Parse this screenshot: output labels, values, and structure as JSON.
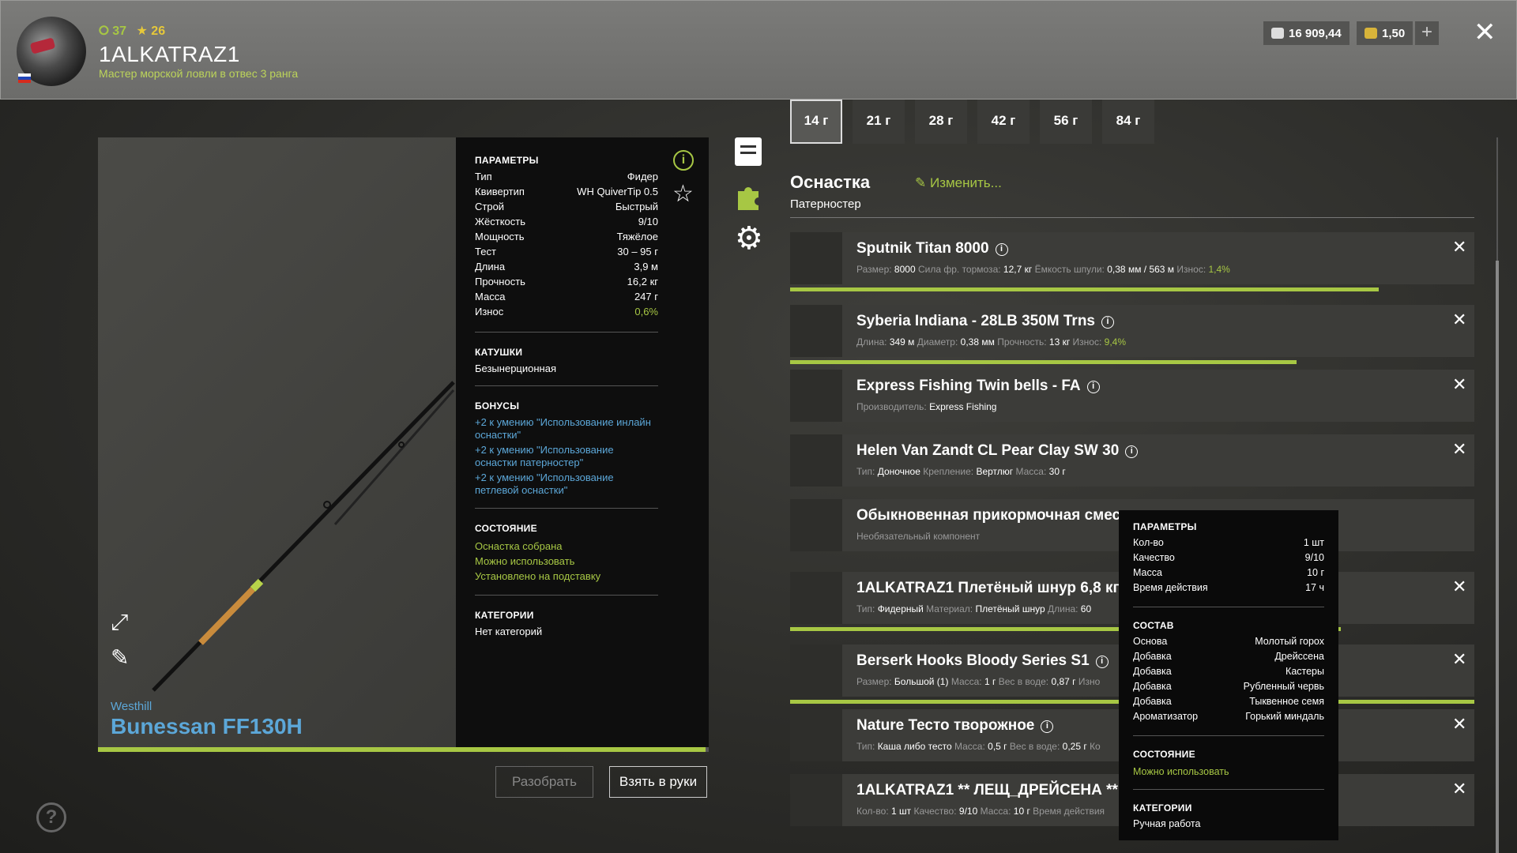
{
  "header": {
    "level": "37",
    "stars": "26",
    "player_name": "1ALKATRAZ1",
    "player_title": "Мастер морской ловли в отвес 3 ранга",
    "silver": "16 909,44",
    "gold": "1,50",
    "plus": "+",
    "close": "✕"
  },
  "rod": {
    "brand": "Westhill",
    "name": "Bunessan FF130H",
    "progress": 0.995,
    "params_title": "ПАРАМЕТРЫ",
    "params": [
      {
        "k": "Тип",
        "v": "Фидер"
      },
      {
        "k": "Квивертип",
        "v": "WH QuiverTip 0.5"
      },
      {
        "k": "Строй",
        "v": "Быстрый"
      },
      {
        "k": "Жёсткость",
        "v": "9/10"
      },
      {
        "k": "Мощность",
        "v": "Тяжёлое"
      },
      {
        "k": "Тест",
        "v": "30 – 95 г"
      },
      {
        "k": "Длина",
        "v": "3,9 м"
      },
      {
        "k": "Прочность",
        "v": "16,2 кг"
      },
      {
        "k": "Масса",
        "v": "247 г"
      },
      {
        "k": "Износ",
        "v": "0,6%"
      }
    ],
    "reels_title": "КАТУШКИ",
    "reels_value": "Безынерционная",
    "bonuses_title": "БОНУСЫ",
    "bonuses": [
      "+2 к умению \"Использование инлайн оснастки\"",
      "+2 к умению \"Использование оснастки патерностер\"",
      "+2 к умению \"Использование петлевой оснастки\""
    ],
    "state_title": "СОСТОЯНИЕ",
    "states": [
      "Оснастка собрана",
      "Можно использовать",
      "Установлено на подставку"
    ],
    "categories_title": "КАТЕГОРИИ",
    "categories_value": "Нет категорий"
  },
  "buttons": {
    "disassemble": "Разобрать",
    "take": "Взять в руки",
    "help": "?"
  },
  "weights": [
    "14 г",
    "21 г",
    "28 г",
    "42 г",
    "56 г",
    "84 г"
  ],
  "rig": {
    "title": "Оснастка",
    "subtitle": "Патерностер",
    "edit": "Изменить..."
  },
  "components": [
    {
      "name": "Sputnik Titan 8000",
      "details": [
        [
          "Размер:",
          "8000"
        ],
        [
          "Сила фр. тормоза:",
          "12,7 кг"
        ],
        [
          "Ёмкость шпули:",
          "0,38 мм / 563 м"
        ],
        [
          "Износ:",
          "1,4%"
        ]
      ],
      "bar": 0.86
    },
    {
      "name": "Syberia Indiana - 28LB 350M Trns",
      "details": [
        [
          "Длина:",
          "349 м"
        ],
        [
          "Диаметр:",
          "0,38 мм"
        ],
        [
          "Прочность:",
          "13 кг"
        ],
        [
          "Износ:",
          "9,4%"
        ]
      ],
      "bar": 0.74
    },
    {
      "name": "Express Fishing Twin bells - FA",
      "details": [
        [
          "Производитель:",
          "Express Fishing"
        ]
      ]
    },
    {
      "name": "Helen Van Zandt CL Pear Clay SW 30",
      "details": [
        [
          "Тип:",
          "Доночное"
        ],
        [
          "Крепление:",
          "Вертлюг"
        ],
        [
          "Масса:",
          "30 г"
        ]
      ]
    },
    {
      "name": "Обыкновенная прикормочная смесь",
      "details": [
        [
          "Необязательный компонент",
          ""
        ]
      ]
    },
    {
      "name": "1ALKATRAZ1 Плетёный шнур 6,8 кг",
      "details": [
        [
          "Тип:",
          "Фидерный"
        ],
        [
          "Материал:",
          "Плетёный шнур"
        ],
        [
          "Длина:",
          "60"
        ]
      ],
      "bar": 0.805
    },
    {
      "name": "Berserk Hooks Bloody Series S1",
      "details": [
        [
          "Размер:",
          "Большой (1)"
        ],
        [
          "Масса:",
          "1 г"
        ],
        [
          "Вес в воде:",
          "0,87 г"
        ],
        [
          "Изно",
          ""
        ]
      ],
      "bar": 1.0
    },
    {
      "name": "Nature Тесто творожное",
      "details": [
        [
          "Тип:",
          "Каша либо тесто"
        ],
        [
          "Масса:",
          "0,5 г"
        ],
        [
          "Вес в воде:",
          "0,25 г"
        ],
        [
          "Ко",
          ""
        ]
      ]
    },
    {
      "name": "1ALKATRAZ1 ** ЛЕЩ_ДРЕЙСЕНА **",
      "details": [
        [
          "Кол-во:",
          "1 шт"
        ],
        [
          "Качество:",
          "9/10"
        ],
        [
          "Масса:",
          "10 г"
        ],
        [
          "Время действия",
          ""
        ]
      ]
    }
  ],
  "tooltip": {
    "params_title": "ПАРАМЕТРЫ",
    "params": [
      {
        "k": "Кол-во",
        "v": "1 шт"
      },
      {
        "k": "Качество",
        "v": "9/10"
      },
      {
        "k": "Масса",
        "v": "10 г"
      },
      {
        "k": "Время действия",
        "v": "17 ч"
      }
    ],
    "comp_title": "СОСТАВ",
    "composition": [
      {
        "k": "Основа",
        "v": "Молотый горох"
      },
      {
        "k": "Добавка",
        "v": "Дрейссена"
      },
      {
        "k": "Добавка",
        "v": "Кастеры"
      },
      {
        "k": "Добавка",
        "v": "Рубленный червь"
      },
      {
        "k": "Добавка",
        "v": "Тыквенное семя"
      },
      {
        "k": "Ароматизатор",
        "v": "Горький миндаль"
      }
    ],
    "state_title": "СОСТОЯНИЕ",
    "state_value": "Можно использовать",
    "categories_title": "КАТЕГОРИИ",
    "categories_value": "Ручная работа"
  },
  "colors": {
    "accent": "#a7c744",
    "link": "#5ca7d8",
    "panel": "#0e0e0e"
  },
  "icons": [
    "close-icon",
    "info-icon",
    "star-icon",
    "document-icon",
    "puzzle-icon",
    "gear-icon",
    "expand-icon",
    "pencil-icon",
    "help-icon",
    "edit-icon",
    "silver-coin-icon",
    "gold-coin-icon"
  ]
}
